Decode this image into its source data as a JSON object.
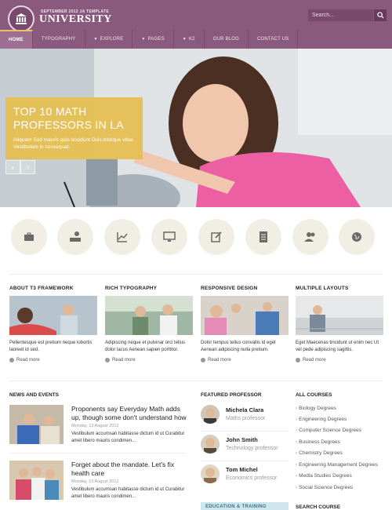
{
  "header": {
    "logo_sub": "SEPTEMBER 2012 JA TEMPLATE",
    "logo_main": "UNIVERSITY",
    "search_placeholder": "Search..."
  },
  "nav": {
    "items": [
      {
        "label": "HOME",
        "active": true,
        "dropdown": false
      },
      {
        "label": "TYPOGRAPHY",
        "active": false,
        "dropdown": false
      },
      {
        "label": "EXPLORE",
        "active": false,
        "dropdown": true
      },
      {
        "label": "PAGES",
        "active": false,
        "dropdown": true
      },
      {
        "label": "K2",
        "active": false,
        "dropdown": true
      },
      {
        "label": "OUR BLOG",
        "active": false,
        "dropdown": false
      },
      {
        "label": "CONTACT US",
        "active": false,
        "dropdown": false
      }
    ]
  },
  "hero": {
    "title_line1": "TOP 10 MATH",
    "title_line2": "PROFESSORS IN LA",
    "text": "Aliquam Sed mauris quis tincidunt Duis tristique vitae Vestibulum in consequat.",
    "prev_icon": "chevron-left-icon",
    "next_icon": "chevron-right-icon"
  },
  "feature_icons": [
    "briefcase-icon",
    "money-icon",
    "chart-icon",
    "monitor-icon",
    "edit-icon",
    "document-icon",
    "users-icon",
    "globe-icon"
  ],
  "features": [
    {
      "title": "ABOUT T3 FRAMEWORK",
      "text": "Pellentesque est pretium neque lobortis laoreet id sed.",
      "read_more": "Read more"
    },
    {
      "title": "RICH TYPOGRAPHY",
      "text": "Adipiscing neque et pulvinar orci tellus dolor lacus Aenean sapien porttitor.",
      "read_more": "Read more"
    },
    {
      "title": "RESPONSIVE DESIGN",
      "text": "Dolor tempus tellus convallis id eget Aenean adipiscing nulla pretium.",
      "read_more": "Read more"
    },
    {
      "title": "MULTIPLE LAYOUTS",
      "text": "Eget Maecenas tincidunt ut enim nec Ut vel pede adipiscing sagittis.",
      "read_more": "Read more"
    }
  ],
  "news": {
    "title": "NEWS AND EVENTS",
    "items": [
      {
        "title": "Proponents say Everyday Math adds up, though some don't understand how",
        "date": "Monday, 13 August 2012",
        "text": "Vestibulum accumsan habitasse dictum id ut Curabitur amet libero mauris condimen..."
      },
      {
        "title": "Forget about the mandate. Let's fix health care",
        "date": "Monday, 13 August 2012",
        "text": "Vestibulum accumsan habitasse dictum id ut Curabitur amet libero mauris condimen..."
      }
    ]
  },
  "professors": {
    "title": "FEATURED PROFESSOR",
    "items": [
      {
        "name": "Michela Clara",
        "role": "Maths professor"
      },
      {
        "name": "John Smith",
        "role": "Technology professor"
      },
      {
        "name": "Tom Michel",
        "role": "Economics professor"
      }
    ]
  },
  "courses": {
    "title": "ALL COURSES",
    "items": [
      "Biology Degrees",
      "Engineering Degrees",
      "Computer Science Degrees",
      "Business Degrees",
      "Chemistry Degrees",
      "Engineering Management Degrees",
      "Media Studies Degrees",
      "Social Science Degrees"
    ]
  },
  "search_course_title": "SEARCH COURSE",
  "edu_banner": "EDUCATION & TRAINING",
  "colors": {
    "header": "#8a5a7e",
    "accent": "#e6be50",
    "icon_bg": "#f1efe3"
  }
}
